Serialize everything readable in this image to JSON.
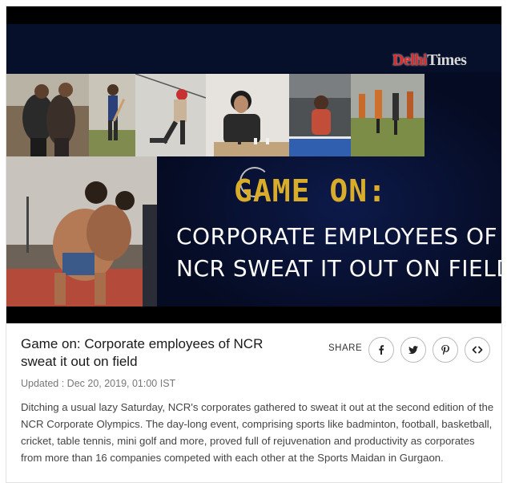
{
  "video": {
    "logo_part1": "Delhi",
    "logo_part2": "Times",
    "headline_line1": "GAME ON:",
    "headline_line2": "CORPORATE EMPLOYEES OF",
    "headline_line3": "NCR SWEAT IT OUT ON FIELD",
    "icon": "loading-spinner-icon"
  },
  "article": {
    "title": "Game on: Corporate employees of NCR sweat it out on field",
    "share_label": "SHARE",
    "share_buttons": [
      {
        "name": "facebook",
        "icon": "facebook-icon"
      },
      {
        "name": "twitter",
        "icon": "twitter-icon"
      },
      {
        "name": "pinterest",
        "icon": "pinterest-icon"
      },
      {
        "name": "embed",
        "icon": "code-icon"
      }
    ],
    "updated": "Updated : Dec 20, 2019, 01:00 IST",
    "body": "Ditching a usual lazy Saturday, NCR's corporates gathered to sweat it out at the second edition of the NCR Corporate Olympics. The day-long event, comprising sports like badminton, football, basketball, cricket, table tennis, mini golf and more, proved full of rejuvenation and productivity as corporates from more than 16 companies competed with each other at the Sports Maidan in Gurgaon."
  },
  "colors": {
    "frame_bg": "#07102a",
    "headline_gold": "#d9ad2a",
    "logo_red": "#e02a2a"
  }
}
